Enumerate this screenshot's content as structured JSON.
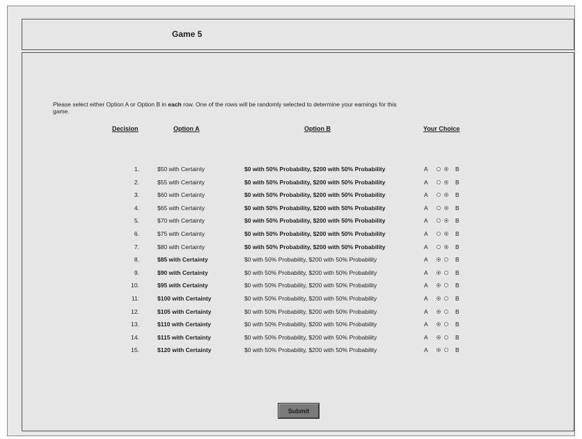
{
  "game": {
    "title": "Game 5"
  },
  "instructions": {
    "before": "Please select either Option A or Option B in ",
    "emphasis": "each",
    "after": " row. One of the rows will be randomly selected to determine your earnings for this game."
  },
  "headers": {
    "decision": "Decision",
    "option_a": "Option A",
    "option_b": "Option B",
    "your_choice": "Your Choice"
  },
  "choice_labels": {
    "a": "A",
    "b": "B"
  },
  "rows": [
    {
      "num": "1.",
      "option_a": "$50 with Certainty",
      "option_b": "$0 with 50% Probability, $200 with 50% Probability",
      "selected": "B"
    },
    {
      "num": "2.",
      "option_a": "$55 with Certainty",
      "option_b": "$0 with 50% Probability, $200 with 50% Probability",
      "selected": "B"
    },
    {
      "num": "3.",
      "option_a": "$60 with Certainty",
      "option_b": "$0 with 50% Probability, $200 with 50% Probability",
      "selected": "B"
    },
    {
      "num": "4.",
      "option_a": "$65 with Certainty",
      "option_b": "$0 with 50% Probability, $200 with 50% Probability",
      "selected": "B"
    },
    {
      "num": "5.",
      "option_a": "$70 with Certainty",
      "option_b": "$0 with 50% Probability, $200 with 50% Probability",
      "selected": "B"
    },
    {
      "num": "6.",
      "option_a": "$75 with Certainty",
      "option_b": "$0 with 50% Probability, $200 with 50% Probability",
      "selected": "B"
    },
    {
      "num": "7.",
      "option_a": "$80 with Certainty",
      "option_b": "$0 with 50% Probability, $200 with 50% Probability",
      "selected": "B"
    },
    {
      "num": "8.",
      "option_a": "$85 with Certainty",
      "option_b": "$0 with 50% Probability, $200 with 50% Probability",
      "selected": "A"
    },
    {
      "num": "9.",
      "option_a": "$90 with Certainty",
      "option_b": "$0 with 50% Probability, $200 with 50% Probability",
      "selected": "A"
    },
    {
      "num": "10.",
      "option_a": "$95 with Certainty",
      "option_b": "$0 with 50% Probability, $200 with 50% Probability",
      "selected": "A"
    },
    {
      "num": "11.",
      "option_a": "$100 with Certainty",
      "option_b": "$0 with 50% Probability, $200 with 50% Probability",
      "selected": "A"
    },
    {
      "num": "12.",
      "option_a": "$105 with Certainty",
      "option_b": "$0 with 50% Probability, $200 with 50% Probability",
      "selected": "A"
    },
    {
      "num": "13.",
      "option_a": "$110 with Certainty",
      "option_b": "$0 with 50% Probability, $200 with 50% Probability",
      "selected": "A"
    },
    {
      "num": "14.",
      "option_a": "$115 with Certainty",
      "option_b": "$0 with 50% Probability, $200 with 50% Probability",
      "selected": "A"
    },
    {
      "num": "15.",
      "option_a": "$120 with Certainty",
      "option_b": "$0 with 50% Probability, $200 with 50% Probability",
      "selected": "A"
    }
  ],
  "submit": {
    "label": "Submit"
  }
}
